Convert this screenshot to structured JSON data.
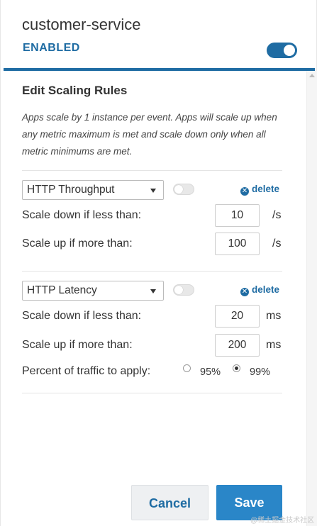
{
  "header": {
    "app_name": "customer-service",
    "status": "ENABLED",
    "enabled": true
  },
  "section": {
    "title": "Edit Scaling Rules",
    "help_text": "Apps scale by 1 instance per event. Apps will scale up when any metric maximum is met and scale down only when all metric minimums are met."
  },
  "rules": [
    {
      "metric": "HTTP Throughput",
      "enabled": false,
      "delete_label": "delete",
      "scale_down_label": "Scale down if less than:",
      "scale_down_value": "10",
      "scale_up_label": "Scale up if more than:",
      "scale_up_value": "100",
      "unit": "/s"
    },
    {
      "metric": "HTTP Latency",
      "enabled": false,
      "delete_label": "delete",
      "scale_down_label": "Scale down if less than:",
      "scale_down_value": "20",
      "scale_up_label": "Scale up if more than:",
      "scale_up_value": "200",
      "unit": "ms",
      "percent_label": "Percent of traffic to apply:",
      "percent_options": [
        "95%",
        "99%"
      ],
      "percent_selected": "99%"
    }
  ],
  "buttons": {
    "cancel": "Cancel",
    "save": "Save"
  },
  "watermark": "@稀土掘金技术社区",
  "colors": {
    "accent": "#1f6ca3",
    "save_button": "#2a86c8",
    "cancel_button": "#eef0f2"
  }
}
